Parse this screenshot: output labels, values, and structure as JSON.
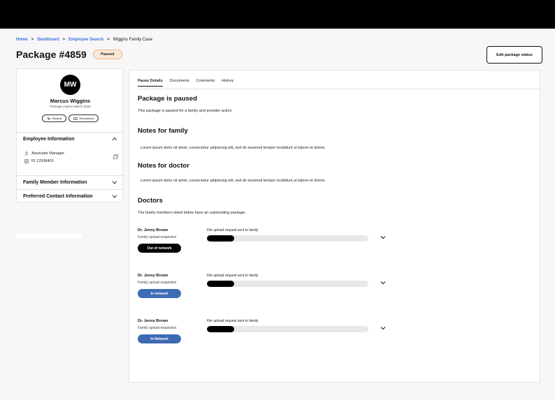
{
  "breadcrumb": {
    "home": "Home",
    "dashboard": "Dashboard",
    "employee_search": "Employee Search",
    "current": "Wiggins Family Case",
    "separator": ">"
  },
  "header": {
    "title": "Package #4859",
    "status": "Paused",
    "edit_button": "Edit package status"
  },
  "profile": {
    "initials": "MW",
    "name": "Marcus Wiggins",
    "subtitle": "Package expires March 2026",
    "pills": [
      "Medical",
      "Educational"
    ],
    "sections": {
      "employee": {
        "title": "Employee Information",
        "role": "Associate Manager",
        "id": "ID 12938403"
      },
      "family": {
        "title": "Family Member Information"
      },
      "contact": {
        "title": "Preferred Contact Information"
      }
    }
  },
  "tabs": [
    "Pause Details",
    "Documents",
    "Comments",
    "History"
  ],
  "content": {
    "paused_heading": "Package is paused",
    "paused_text": "This package is paused for a family and provider action",
    "family_heading": "Notes for family",
    "family_text": "Lorem ipsum dolor sit amet, consectetur adipiscing elit, sed do eiusmod tempor incididunt ut labore et dolore.",
    "doctor_heading": "Notes for doctor",
    "doctor_text": "Lorem ipsum dolor sit amet, consectetur adipiscing elit, sed do eiusmod tempor incididunt ut labore et dolore.",
    "doctors_heading": "Doctors",
    "doctors_text": "The family members listed below have an outstanding package."
  },
  "doctors": [
    {
      "name": "Dr. Jenny Brown",
      "subtitle": "Family upload requested",
      "upload_label": "File upload request sent to family",
      "progress": 0.17,
      "badge": "Out of network",
      "badge_color": "#000000"
    },
    {
      "name": "Dr. Jenny Brown",
      "subtitle": "Family upload requested",
      "upload_label": "File upload request sent to family",
      "progress": 0.17,
      "badge": "In network",
      "badge_color": "#3d6bb3"
    },
    {
      "name": "Dr. Jenny Brown",
      "subtitle": "Family upload requested",
      "upload_label": "File upload request sent to family",
      "progress": 0.17,
      "badge": "In Network",
      "badge_color": "#3d6bb3"
    }
  ],
  "colors": {
    "link": "#3a6ee0",
    "badge_bg": "#fbe9d8",
    "accent_blue": "#3d6bb3"
  }
}
